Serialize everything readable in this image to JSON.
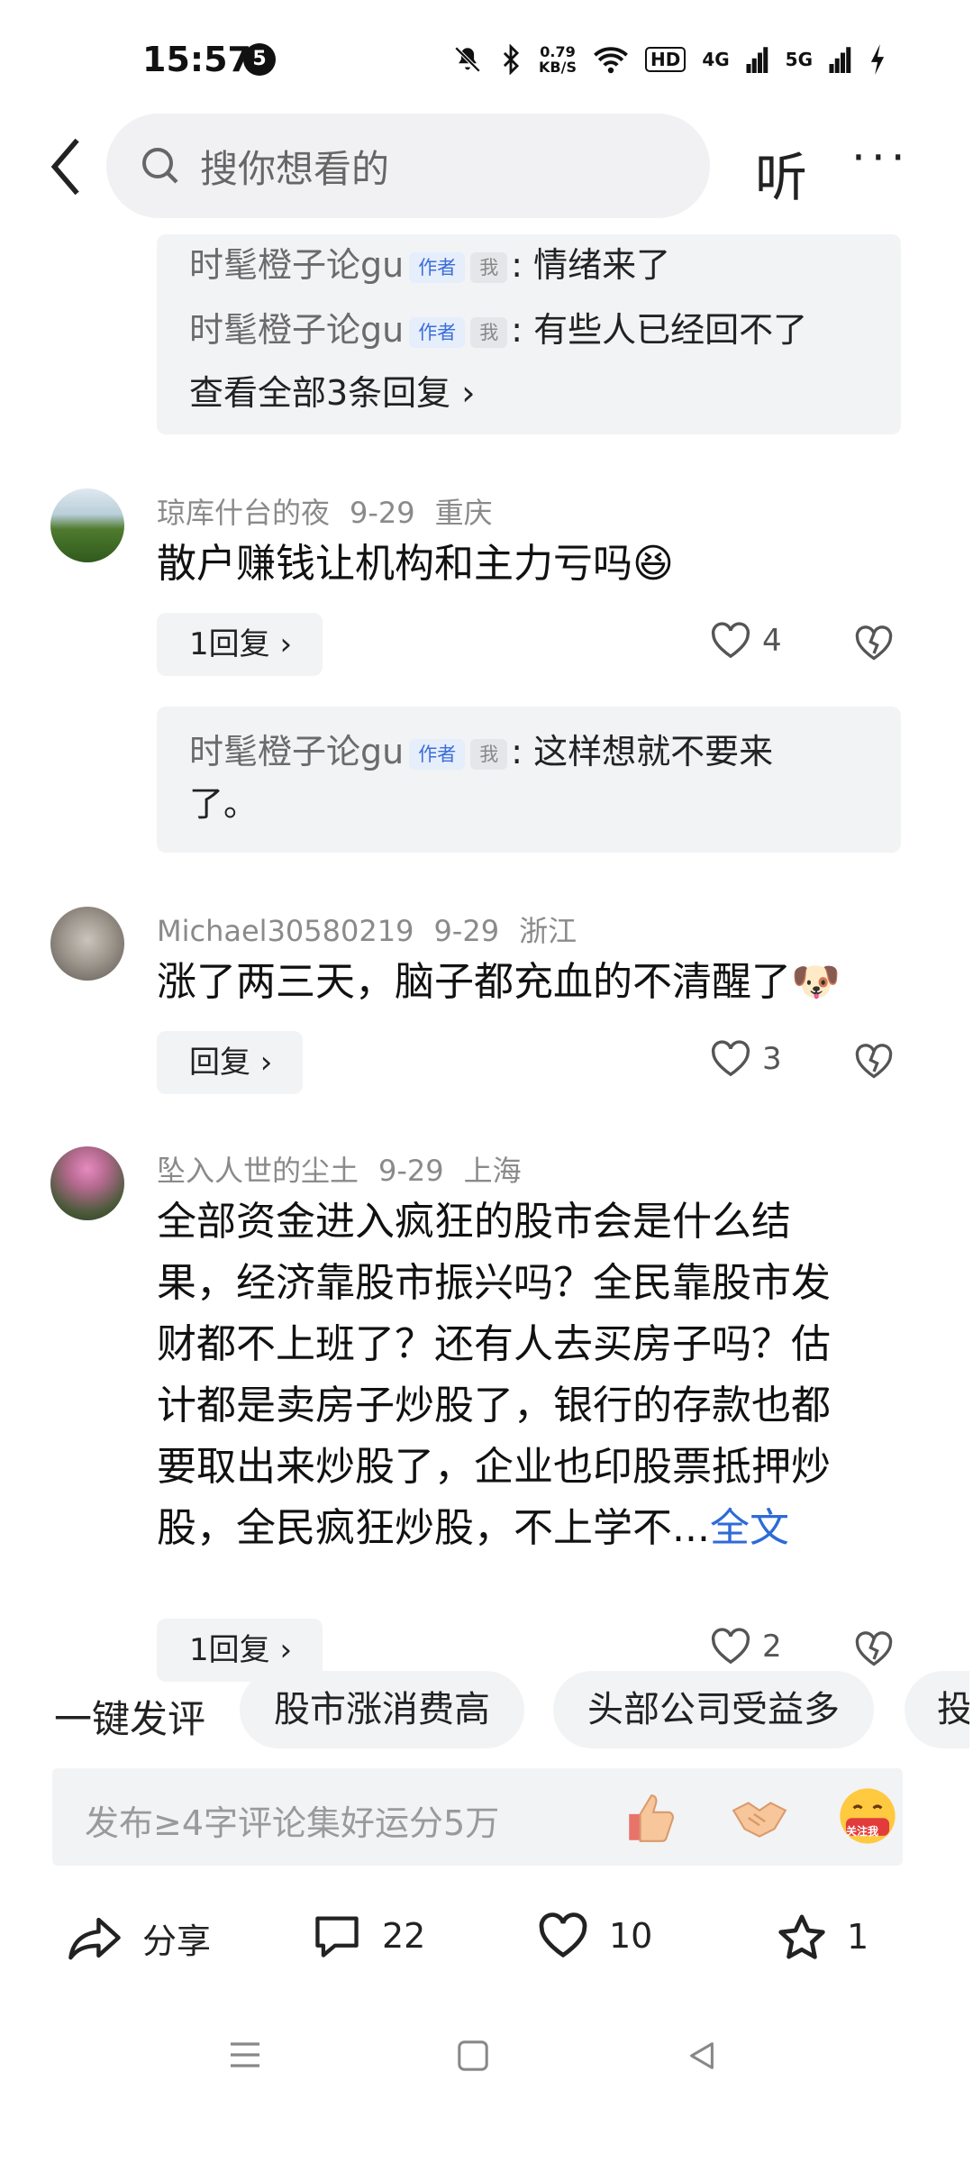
{
  "status": {
    "time": "15:57",
    "badge": "5",
    "net_speed_value": "0.79",
    "net_speed_unit": "KB/S",
    "hd": "HD",
    "sig1": "4G",
    "sig2": "5G"
  },
  "header": {
    "search_placeholder": "搜你想看的",
    "listen_label": "听",
    "more_label": "···"
  },
  "thread_top": {
    "replies": [
      {
        "name": "时髦橙子论gu",
        "tag_author": "作者",
        "tag_me": "我",
        "text": ": 情绪来了"
      },
      {
        "name": "时髦橙子论gu",
        "tag_author": "作者",
        "tag_me": "我",
        "text": ": 有些人已经回不了"
      }
    ],
    "view_all": "查看全部3条回复 ›"
  },
  "comments": [
    {
      "user": "琼库什台的夜",
      "date": "9-29",
      "location": "重庆",
      "text": "散户赚钱让机构和主力亏吗😆",
      "reply_btn": "1回复 ›",
      "likes": "4",
      "reply": {
        "name": "时髦橙子论gu",
        "tag_author": "作者",
        "tag_me": "我",
        "text": ": 这样想就不要来",
        "text2": "了。"
      }
    },
    {
      "user": "Michael30580219",
      "date": "9-29",
      "location": "浙江",
      "text": "涨了两三天，脑子都充血的不清醒了🐶",
      "reply_btn": "回复 ›",
      "likes": "3"
    },
    {
      "user": "坠入人世的尘土",
      "date": "9-29",
      "location": "上海",
      "lines": [
        "全部资金进入疯狂的股市会是什么结",
        "果，经济靠股市振兴吗？全民靠股市发",
        "财都不上班了？还有人去买房子吗？估",
        "计都是卖房子炒股了，银行的存款也都",
        "要取出来炒股了，企业也印股票抵押炒",
        "股，全民疯狂炒股，不上学不..."
      ],
      "full_link": "全文",
      "reply_btn": "1回复 ›",
      "likes": "2"
    }
  ],
  "quick_comment": {
    "label": "一键发评",
    "chips": [
      "股市涨消费高",
      "头部公司受益多",
      "投"
    ]
  },
  "input": {
    "placeholder": "发布≥4字评论集好运分5万",
    "sticker3": "关注我"
  },
  "actions": {
    "share": "分享",
    "comments": "22",
    "likes": "10",
    "favorites": "1"
  },
  "colors": {
    "accent_blue": "#2d6bd6",
    "panel_bg": "#f2f3f5",
    "text_gray": "#8a8a8a"
  }
}
